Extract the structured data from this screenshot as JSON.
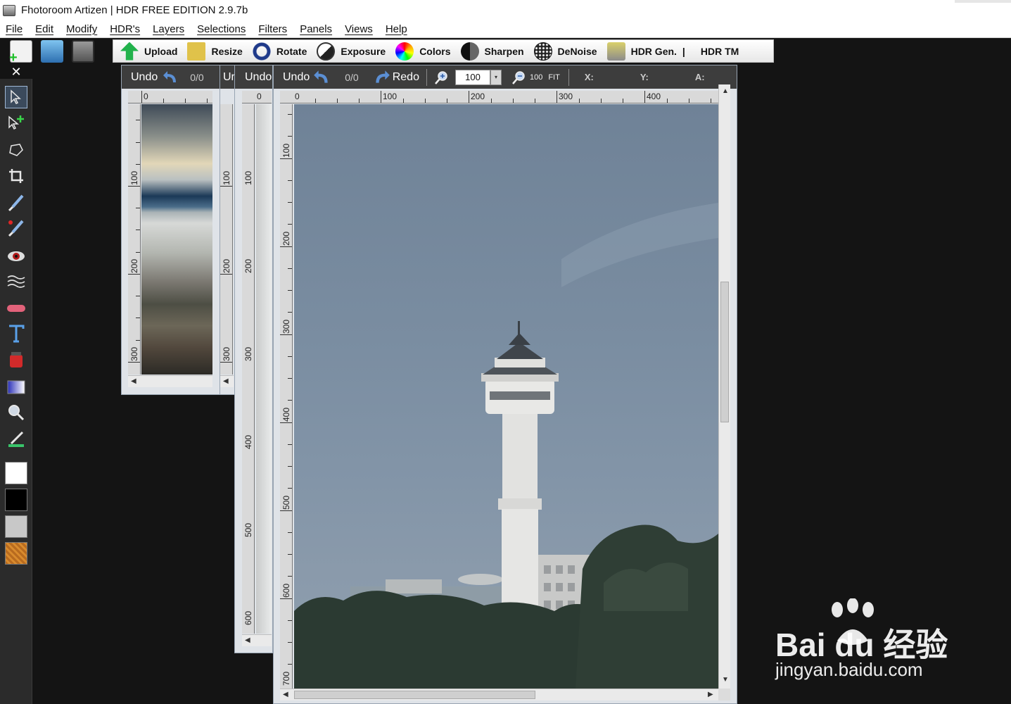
{
  "window": {
    "title": "Fhotoroom Artizen | HDR FREE EDITION 2.9.7b"
  },
  "menu": [
    {
      "label": "File"
    },
    {
      "label": "Edit"
    },
    {
      "label": "Modify"
    },
    {
      "label": "HDR's"
    },
    {
      "label": "Layers"
    },
    {
      "label": "Selections"
    },
    {
      "label": "Filters"
    },
    {
      "label": "Panels"
    },
    {
      "label": "Views"
    },
    {
      "label": "Help"
    }
  ],
  "toolbar": {
    "upload": "Upload",
    "resize": "Resize",
    "rotate": "Rotate",
    "exposure": "Exposure",
    "colors": "Colors",
    "sharpen": "Sharpen",
    "denoise": "DeNoise",
    "hdr_gen": "HDR Gen.",
    "separator": "|",
    "hdr_tm": "HDR TM"
  },
  "toolstrip": {
    "close": "✕"
  },
  "doc_left": {
    "undo": "Undo",
    "undo_count": "0/0",
    "ruler_zero": "0",
    "vlabels": [
      "100",
      "200",
      "300"
    ]
  },
  "doc_second": {
    "undo": "Ur",
    "vlabels": [
      "100",
      "200",
      "300"
    ]
  },
  "doc_third": {
    "undo": "Undo",
    "ruler_zero": "0",
    "vlabels": [
      "100",
      "200",
      "300",
      "400",
      "500",
      "600"
    ]
  },
  "doc_main": {
    "undo": "Undo",
    "undo_count": "0/0",
    "redo": "Redo",
    "zoom_value": "100",
    "zoom_100": "100",
    "zoom_fit": "FIT",
    "x_label": "X:",
    "y_label": "Y:",
    "a_label": "A:",
    "hlabels": [
      "0",
      "100",
      "200",
      "300",
      "400"
    ],
    "vlabels": [
      "100",
      "200",
      "300",
      "400",
      "500",
      "600",
      "700"
    ]
  },
  "watermark": {
    "brand": "Bai du 经验",
    "url": "jingyan.baidu.com"
  }
}
